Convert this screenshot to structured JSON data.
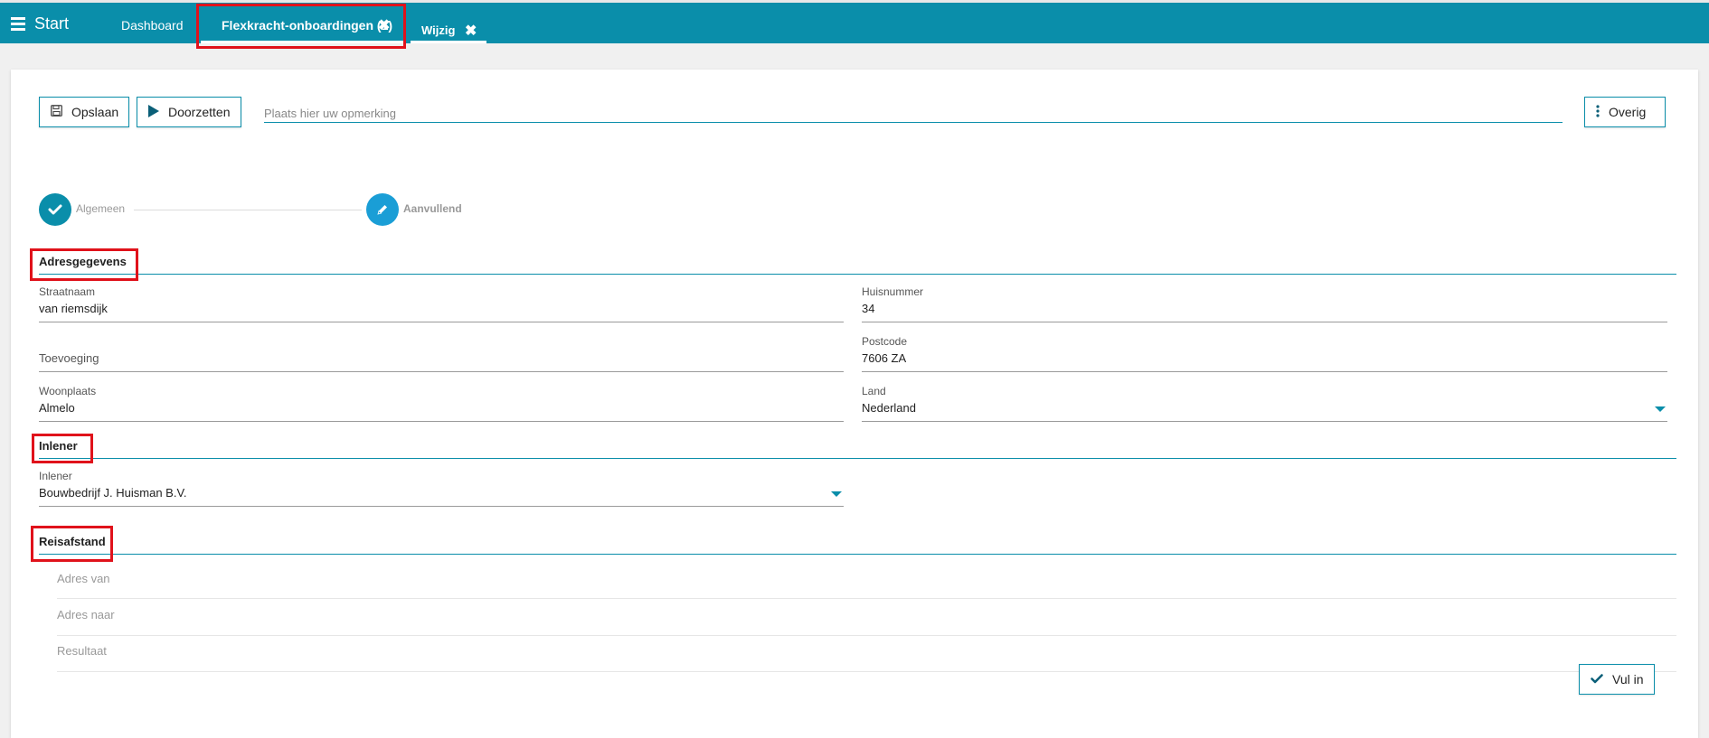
{
  "header": {
    "menu_label": "Start",
    "tabs": [
      {
        "label": "Dashboard"
      },
      {
        "label": "Flexkracht-onboardingen (1)"
      },
      {
        "label": "Wijzig"
      }
    ],
    "close_glyph": "✖"
  },
  "toolbar": {
    "save_label": "Opslaan",
    "forward_label": "Doorzetten",
    "remark_placeholder": "Plaats hier uw opmerking",
    "more_label": "Overig"
  },
  "steps": [
    {
      "label": "Algemeen",
      "state": "done"
    },
    {
      "label": "Aanvullend",
      "state": "edit"
    }
  ],
  "address": {
    "title": "Adresgegevens",
    "street_label": "Straatnaam",
    "street_value": "van riemsdijk",
    "number_label": "Huisnummer",
    "number_value": "34",
    "addition_label": "Toevoeging",
    "addition_value": "",
    "postcode_label": "Postcode",
    "postcode_value": "7606 ZA",
    "city_label": "Woonplaats",
    "city_value": "Almelo",
    "country_label": "Land",
    "country_value": "Nederland"
  },
  "inlener": {
    "title": "Inlener",
    "field_label": "Inlener",
    "field_value": "Bouwbedrijf J. Huisman B.V."
  },
  "reisafstand": {
    "title": "Reisafstand",
    "from_label": "Adres van",
    "to_label": "Adres naar",
    "result_label": "Resultaat",
    "fill_button": "Vul in"
  },
  "colors": {
    "accent": "#0a8eaa",
    "highlight": "#e0121b",
    "step_done": "#0a8eaa",
    "step_edit": "#1a9ed6"
  }
}
